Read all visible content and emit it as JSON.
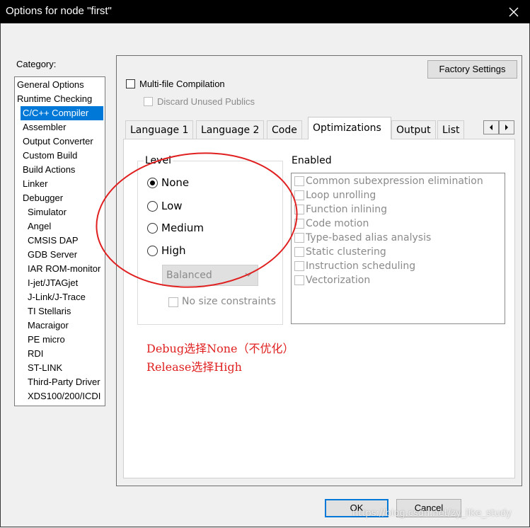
{
  "window": {
    "title": "Options for node \"first\"",
    "close_icon": "close-icon"
  },
  "category": {
    "label": "Category:",
    "items": [
      {
        "label": "General Options",
        "indent": 0
      },
      {
        "label": "Runtime Checking",
        "indent": 0
      },
      {
        "label": "C/C++ Compiler",
        "indent": 1,
        "selected": true
      },
      {
        "label": "Assembler",
        "indent": 1
      },
      {
        "label": "Output Converter",
        "indent": 1
      },
      {
        "label": "Custom Build",
        "indent": 1
      },
      {
        "label": "Build Actions",
        "indent": 1
      },
      {
        "label": "Linker",
        "indent": 1
      },
      {
        "label": "Debugger",
        "indent": 1
      },
      {
        "label": "Simulator",
        "indent": 2
      },
      {
        "label": "Angel",
        "indent": 2
      },
      {
        "label": "CMSIS DAP",
        "indent": 2
      },
      {
        "label": "GDB Server",
        "indent": 2
      },
      {
        "label": "IAR ROM-monitor",
        "indent": 2
      },
      {
        "label": "I-jet/JTAGjet",
        "indent": 2
      },
      {
        "label": "J-Link/J-Trace",
        "indent": 2
      },
      {
        "label": "TI Stellaris",
        "indent": 2
      },
      {
        "label": "Macraigor",
        "indent": 2
      },
      {
        "label": "PE micro",
        "indent": 2
      },
      {
        "label": "RDI",
        "indent": 2
      },
      {
        "label": "ST-LINK",
        "indent": 2
      },
      {
        "label": "Third-Party Driver",
        "indent": 2
      },
      {
        "label": "XDS100/200/ICDI",
        "indent": 2
      }
    ]
  },
  "factory_settings_label": "Factory Settings",
  "multi_file": {
    "label": "Multi-file Compilation",
    "checked": false
  },
  "discard_unused": {
    "label": "Discard Unused Publics",
    "checked": false,
    "disabled": true
  },
  "tabs": [
    {
      "label": "Language 1"
    },
    {
      "label": "Language 2"
    },
    {
      "label": "Code"
    },
    {
      "label": "Optimizations",
      "active": true
    },
    {
      "label": "Output"
    },
    {
      "label": "List"
    }
  ],
  "tab_scroll": {
    "left_icon": "arrow-left-icon",
    "right_icon": "arrow-right-icon"
  },
  "level": {
    "title": "Level",
    "options": [
      {
        "label": "None",
        "selected": true
      },
      {
        "label": "Low",
        "selected": false
      },
      {
        "label": "Medium",
        "selected": false
      },
      {
        "label": "High",
        "selected": false
      }
    ],
    "balance_select": {
      "value": "Balanced",
      "disabled": true
    },
    "no_size_constraints": {
      "label": "No size constraints",
      "checked": false,
      "disabled": true
    }
  },
  "enabled": {
    "title": "Enabled",
    "options": [
      "Common subexpression elimination",
      "Loop unrolling",
      "Function inlining",
      "Code motion",
      "Type-based alias analysis",
      "Static clustering",
      "Instruction scheduling",
      "Vectorization"
    ]
  },
  "annotation": {
    "line1": "Debug选择None（不优化）",
    "line2": "Release选择High",
    "color": "#e02020"
  },
  "buttons": {
    "ok": "OK",
    "cancel": "Cancel"
  },
  "watermark": "https://blog.csdn.net/zy_like_study"
}
